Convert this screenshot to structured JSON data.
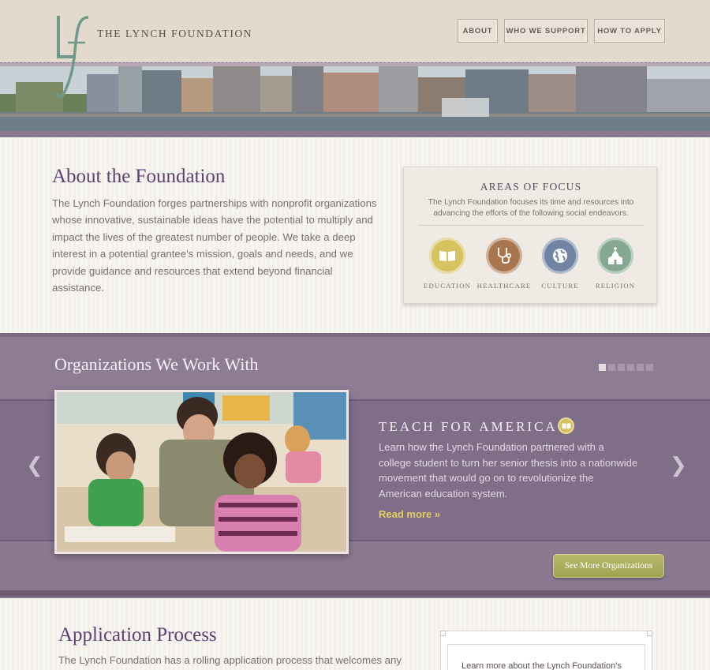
{
  "header": {
    "brand": "THE LYNCH FOUNDATION",
    "nav": [
      "ABOUT",
      "WHO WE SUPPORT",
      "HOW TO APPLY"
    ]
  },
  "about": {
    "title": "About the Foundation",
    "text": "The Lynch Foundation forges partnerships with nonprofit organizations whose innovative, sustainable ideas have the potential to multiply and impact the lives of the greatest number of people. We take a deep interest in a potential grantee's mission, goals and needs, and we provide guidance and resources that extend beyond financial assistance."
  },
  "focus": {
    "title": "AREAS OF FOCUS",
    "desc": "The Lynch Foundation focuses its time and resources into advancing the efforts of the following social endeavors.",
    "items": [
      {
        "label": "EDUCATION",
        "icon": "book-icon",
        "color": "#d6c25f"
      },
      {
        "label": "HEALTHCARE",
        "icon": "stethoscope-icon",
        "color": "#a9754f"
      },
      {
        "label": "CULTURE",
        "icon": "globe-icon",
        "color": "#7185a3"
      },
      {
        "label": "RELIGION",
        "icon": "church-icon",
        "color": "#86a892"
      }
    ]
  },
  "orgs": {
    "title": "Organizations We Work With",
    "slide_count": 6,
    "active_slide": 1,
    "name": "TEACH FOR AMERICA",
    "desc": "Learn how the Lynch Foundation partnered with a college student to turn her senior thesis into a nationwide movement that would go on to revolutionize the American education system.",
    "read_more": "Read more »",
    "see_more": "See More Organizations",
    "prev_arrow": "❮",
    "next_arrow": "❯"
  },
  "application": {
    "title": "Application Process",
    "text": "The Lynch Foundation has a rolling application process that welcomes any",
    "learn_text": "Learn more about the Lynch Foundation’s"
  }
}
